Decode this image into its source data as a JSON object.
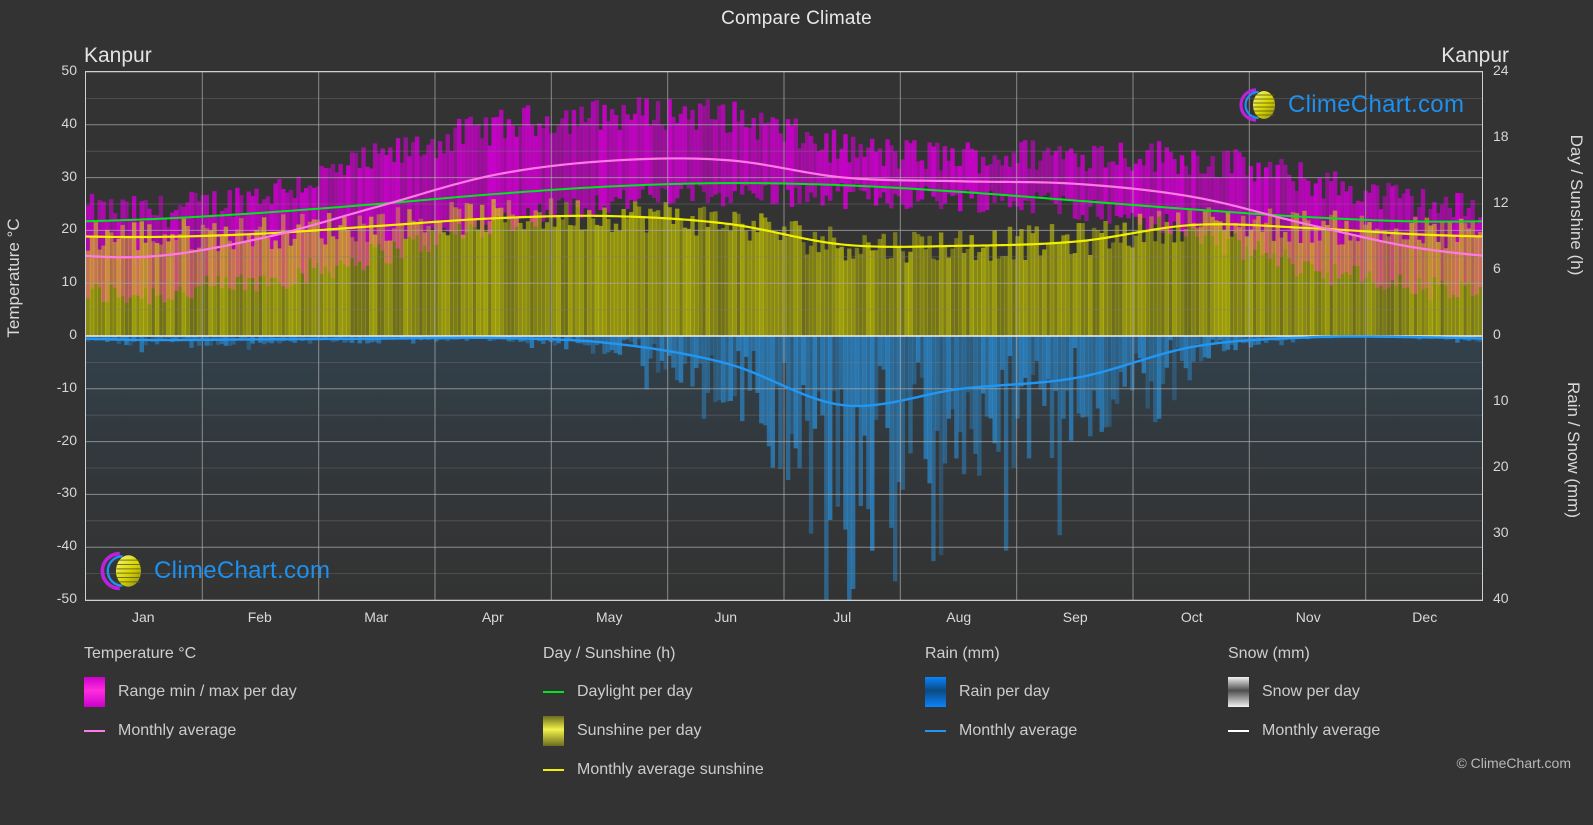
{
  "header": {
    "title": "Compare Climate",
    "city_left": "Kanpur",
    "city_right": "Kanpur"
  },
  "watermark": {
    "brand": "ClimeChart.com",
    "copyright": "© ClimeChart.com"
  },
  "axes": {
    "left_title": "Temperature °C",
    "right_top_title": "Day / Sunshine (h)",
    "right_bottom_title": "Rain / Snow (mm)",
    "left_ticks": [
      "50",
      "40",
      "30",
      "20",
      "10",
      "0",
      "-10",
      "-20",
      "-30",
      "-40",
      "-50"
    ],
    "right_top_ticks": [
      "24",
      "18",
      "12",
      "6",
      "0"
    ],
    "right_bottom_ticks": [
      "0",
      "10",
      "20",
      "30",
      "40"
    ],
    "months": [
      "Jan",
      "Feb",
      "Mar",
      "Apr",
      "May",
      "Jun",
      "Jul",
      "Aug",
      "Sep",
      "Oct",
      "Nov",
      "Dec"
    ]
  },
  "legend": {
    "groups": [
      {
        "title": "Temperature °C",
        "items": [
          {
            "label": "Range min / max per day",
            "marker": "gradient",
            "color": "#cc00cc",
            "color2": "#ff2ddd"
          },
          {
            "label": "Monthly average",
            "marker": "line",
            "color": "#ff7ae6"
          }
        ]
      },
      {
        "title": "Day / Sunshine (h)",
        "items": [
          {
            "label": "Daylight per day",
            "marker": "line",
            "color": "#00e61e"
          },
          {
            "label": "Sunshine per day",
            "marker": "gradient",
            "color": "#6b6b20",
            "color2": "#f2f24a"
          },
          {
            "label": "Monthly average sunshine",
            "marker": "line",
            "color": "#f0f000"
          }
        ]
      },
      {
        "title": "Rain (mm)",
        "items": [
          {
            "label": "Rain per day",
            "marker": "gradient",
            "color": "#0a84ff",
            "color2": "#0b4a80"
          },
          {
            "label": "Monthly average",
            "marker": "line",
            "color": "#2196f3"
          }
        ]
      },
      {
        "title": "Snow (mm)",
        "items": [
          {
            "label": "Snow per day",
            "marker": "gradient",
            "color": "#f2f2f2",
            "color2": "#4d4d4d"
          },
          {
            "label": "Monthly average",
            "marker": "line",
            "color": "#ffffff"
          }
        ]
      }
    ]
  },
  "colors": {
    "background": "#333333",
    "grid": "#8c8c8c",
    "axis": "#cfcfcf",
    "temp_range": "#cc00cc",
    "temp_avg": "#ff7ae6",
    "daylight": "#00e61e",
    "sunshine_band": "#9a9a28",
    "sunshine_avg": "#f0f000",
    "rain_band": "#1a6aa8",
    "rain_avg": "#2196f3",
    "snow": "#e6e6e6"
  },
  "chart_data": {
    "type": "area",
    "title": "Compare Climate",
    "subtitle": "Kanpur",
    "xlabel": "",
    "ylabel": "Temperature °C",
    "ylabel_right_top": "Day / Sunshine (h)",
    "ylabel_right_bottom": "Rain / Snow (mm)",
    "ylim": [
      -50,
      50
    ],
    "ylim_right_top": [
      0,
      24
    ],
    "ylim_right_bottom": [
      0,
      40
    ],
    "grid": true,
    "legend_position": "below",
    "categories": [
      "Jan",
      "Feb",
      "Mar",
      "Apr",
      "May",
      "Jun",
      "Jul",
      "Aug",
      "Sep",
      "Oct",
      "Nov",
      "Dec"
    ],
    "series": [
      {
        "name": "Monthly average temperature",
        "unit": "°C",
        "color": "#ff7ae6",
        "values": [
          15.0,
          18.5,
          24.5,
          30.5,
          33.2,
          33.3,
          30.0,
          29.3,
          28.8,
          26.3,
          21.0,
          16.4
        ]
      },
      {
        "name": "Daily max temperature (range top)",
        "unit": "°C",
        "color": "#cc00cc",
        "values": [
          23.5,
          27.0,
          33.5,
          39.5,
          42.0,
          41.5,
          35.5,
          34.0,
          34.5,
          33.5,
          29.5,
          25.0
        ]
      },
      {
        "name": "Daily min temperature (range bottom)",
        "unit": "°C",
        "color": "#cc00cc",
        "values": [
          8.0,
          10.5,
          15.5,
          21.5,
          25.5,
          27.0,
          26.5,
          26.0,
          24.5,
          19.5,
          13.0,
          9.0
        ]
      },
      {
        "name": "Daylight per day",
        "unit": "h",
        "color": "#00e61e",
        "values": [
          10.6,
          11.2,
          12.0,
          12.9,
          13.6,
          13.9,
          13.7,
          13.1,
          12.3,
          11.5,
          10.8,
          10.4
        ]
      },
      {
        "name": "Monthly average sunshine",
        "unit": "h",
        "color": "#f0f000",
        "values": [
          9.0,
          9.3,
          10.0,
          10.7,
          10.9,
          10.2,
          8.3,
          8.2,
          8.6,
          10.1,
          9.8,
          9.2
        ]
      },
      {
        "name": "Monthly average rain",
        "unit": "mm",
        "color": "#2196f3",
        "values": [
          0.6,
          0.5,
          0.4,
          0.3,
          1.1,
          4.2,
          10.5,
          8.0,
          6.3,
          1.6,
          0.2,
          0.2
        ]
      },
      {
        "name": "Monthly average snow",
        "unit": "mm",
        "color": "#ffffff",
        "values": [
          0,
          0,
          0,
          0,
          0,
          0,
          0,
          0,
          0,
          0,
          0,
          0
        ]
      }
    ]
  }
}
